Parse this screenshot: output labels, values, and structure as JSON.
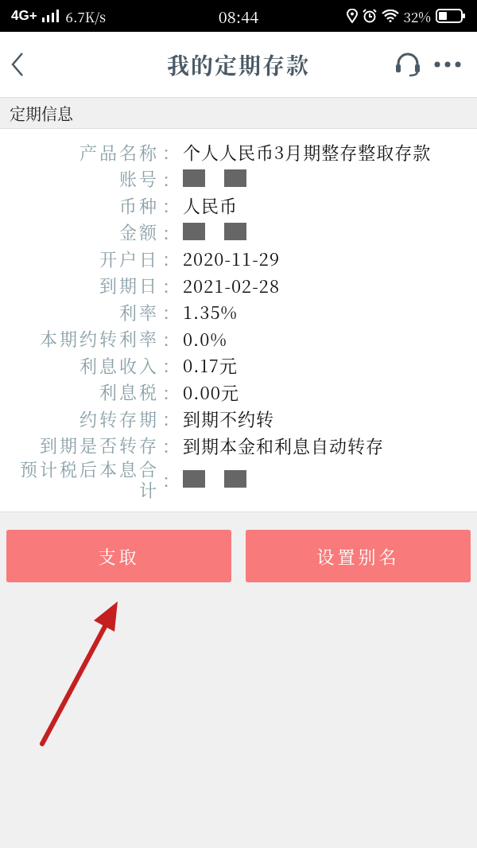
{
  "status_bar": {
    "network": "4G+",
    "speed": "6.7K/s",
    "time": "08:44",
    "battery": "32%"
  },
  "header": {
    "title": "我的定期存款"
  },
  "section": {
    "title": "定期信息"
  },
  "details": [
    {
      "label": "产品名称",
      "kind": "text",
      "value": "个人人民币3月期整存整取存款"
    },
    {
      "label": "账号",
      "kind": "masked"
    },
    {
      "label": "币种",
      "kind": "text",
      "value": "人民币"
    },
    {
      "label": "金额",
      "kind": "masked"
    },
    {
      "label": "开户日",
      "kind": "text",
      "value": "2020-11-29"
    },
    {
      "label": "到期日",
      "kind": "text",
      "value": "2021-02-28"
    },
    {
      "label": "利率",
      "kind": "text",
      "value": "1.35%"
    },
    {
      "label": "本期约转利率",
      "kind": "text",
      "value": "0.0%"
    },
    {
      "label": "利息收入",
      "kind": "text",
      "value": "0.17元"
    },
    {
      "label": "利息税",
      "kind": "text",
      "value": "0.00元"
    },
    {
      "label": "约转存期",
      "kind": "text",
      "value": "到期不约转"
    },
    {
      "label": "到期是否转存",
      "kind": "text",
      "value": "到期本金和利息自动转存"
    },
    {
      "label": "预计税后本息合计",
      "kind": "masked"
    }
  ],
  "separator": "：",
  "buttons": [
    "支取",
    "设置别名"
  ]
}
